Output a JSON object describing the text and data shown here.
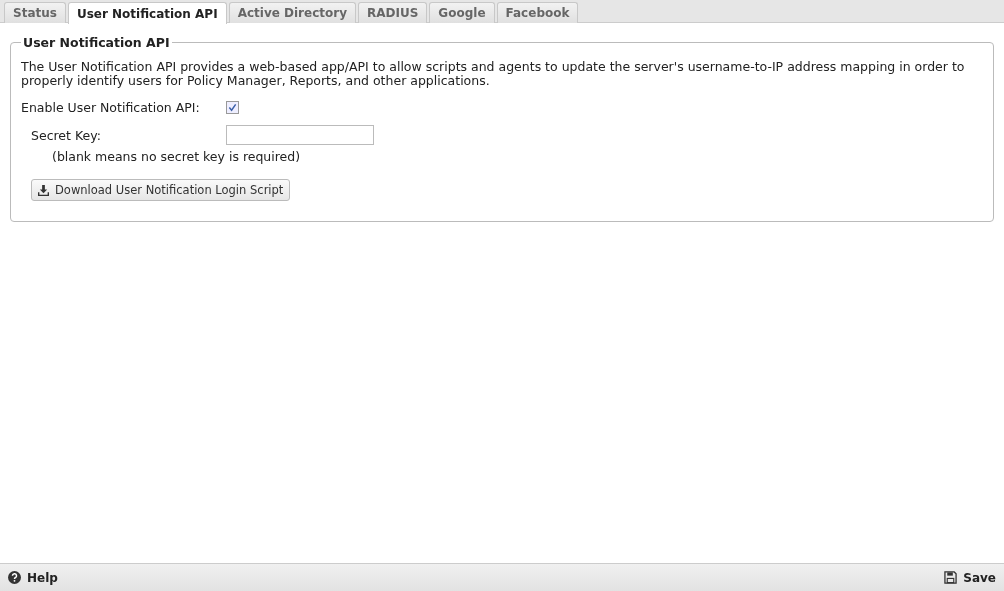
{
  "tabs": [
    {
      "label": "Status",
      "selected": false
    },
    {
      "label": "User Notification API",
      "selected": true
    },
    {
      "label": "Active Directory",
      "selected": false
    },
    {
      "label": "RADIUS",
      "selected": false
    },
    {
      "label": "Google",
      "selected": false
    },
    {
      "label": "Facebook",
      "selected": false
    }
  ],
  "panel": {
    "legend": "User Notification API",
    "description": "The User Notification API provides a web-based app/API to allow scripts and agents to update the server's username-to-IP address mapping in order to properly identify users for Policy Manager, Reports, and other applications.",
    "enable": {
      "label": "Enable User Notification API:",
      "checked": true
    },
    "secret_key": {
      "label": "Secret Key:",
      "hint": "(blank means no secret key is required)"
    },
    "download_button": "Download User Notification Login Script"
  },
  "footer": {
    "help": "Help",
    "save": "Save"
  }
}
